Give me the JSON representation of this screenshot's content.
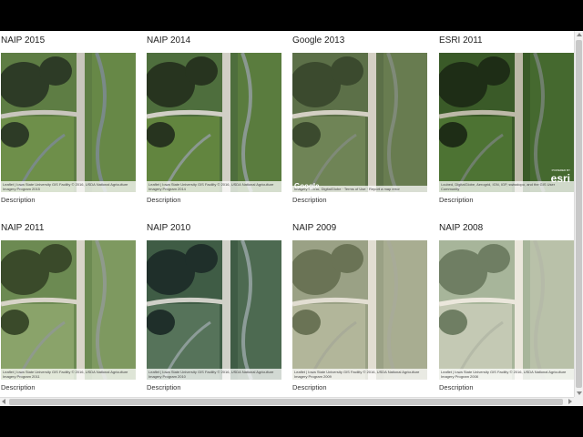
{
  "rows": [
    [
      {
        "title": "NAIP 2015",
        "desc": "Description",
        "attribution": "Leaflet | Iowa State University GIS Facility © 2016, USDA National Agriculture Imagery Program 2015",
        "provider": "naip"
      },
      {
        "title": "NAIP 2014",
        "desc": "Description",
        "attribution": "Leaflet | Iowa State University GIS Facility © 2016, USDA National Agriculture Imagery Program 2014",
        "provider": "naip"
      },
      {
        "title": "Google 2013",
        "desc": "Description",
        "attribution": "Imagery ©2016, DigitalGlobe · Terms of Use · Report a map error",
        "logo": "Google",
        "provider": "google"
      },
      {
        "title": "ESRI 2011",
        "desc": "Description",
        "attribution": "i-cubed, DigitalGlobe, Aerogrid, IGN, IGP, swisstopo, and the GIS User Community",
        "logo": "esri",
        "powered": "POWERED BY",
        "provider": "esri"
      }
    ],
    [
      {
        "title": "NAIP 2011",
        "desc": "Description",
        "attribution": "Leaflet | Iowa State University GIS Facility © 2016, USDA National Agriculture Imagery Program 2011",
        "provider": "naip"
      },
      {
        "title": "NAIP 2010",
        "desc": "Description",
        "attribution": "Leaflet | Iowa State University GIS Facility © 2016, USDA National Agriculture Imagery Program 2010",
        "provider": "naip"
      },
      {
        "title": "NAIP 2009",
        "desc": "Description",
        "attribution": "Leaflet | Iowa State University GIS Facility © 2016, USDA National Agriculture Imagery Program 2009",
        "provider": "naip"
      },
      {
        "title": "NAIP 2008",
        "desc": "Description",
        "attribution": "Leaflet | Iowa State University GIS Facility © 2016, USDA National Agriculture Imagery Program 2008",
        "provider": "naip"
      }
    ]
  ],
  "palettes": {
    "c00": {
      "bg": "#5e7d44",
      "field": "#6e8f4a",
      "road": "#c9c6bd",
      "trees": "#2d3b26",
      "water": "#7a8a88"
    },
    "c01": {
      "bg": "#4e6e3d",
      "field": "#62853f",
      "road": "#d1cfc6",
      "trees": "#27341f",
      "water": "#8a9890"
    },
    "c02": {
      "bg": "#5c7048",
      "field": "#6f8456",
      "road": "#d4d0c4",
      "trees": "#3b4a2e",
      "water": "#7f8a78"
    },
    "c03": {
      "bg": "#3a5a28",
      "field": "#4d7333",
      "road": "#bdb9a8",
      "trees": "#1e2d16",
      "water": "#6f7f6c"
    },
    "c10": {
      "bg": "#6c8a52",
      "field": "#8aa36a",
      "road": "#d8d4c8",
      "trees": "#3a4a2a",
      "water": "#8f9a8c"
    },
    "c11": {
      "bg": "#3f5c45",
      "field": "#56735a",
      "road": "#d0d0c8",
      "trees": "#1f2f2a",
      "water": "#8c9c98"
    },
    "c12": {
      "bg": "#9aa185",
      "field": "#b2b69a",
      "road": "#e2ded2",
      "trees": "#6a7355",
      "water": "#a8ab98"
    },
    "c13": {
      "bg": "#a7b59a",
      "field": "#c4c9b4",
      "road": "#ebe7dc",
      "trees": "#6f7e63",
      "water": "#b5baa8"
    }
  }
}
